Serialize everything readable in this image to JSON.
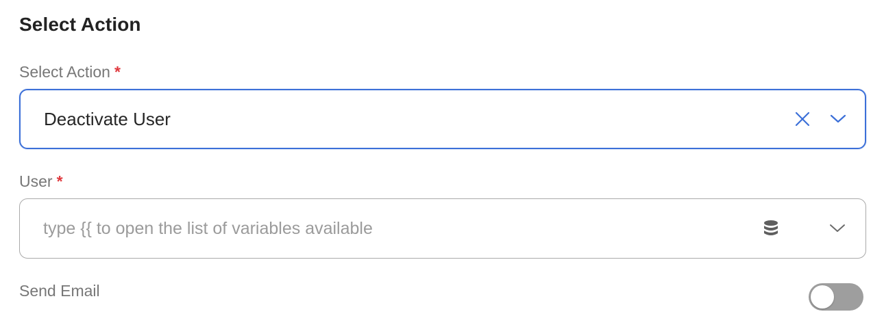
{
  "section": {
    "title": "Select Action"
  },
  "action_field": {
    "label": "Select Action",
    "required_mark": "*",
    "value": "Deactivate User",
    "clear_icon": "close-icon",
    "dropdown_icon": "chevron-down-icon"
  },
  "user_field": {
    "label": "User",
    "required_mark": "*",
    "placeholder": "type {{ to open the list of variables available",
    "variables_icon": "database-icon",
    "dropdown_icon": "chevron-down-icon"
  },
  "send_email": {
    "label": "Send Email",
    "enabled": false
  },
  "colors": {
    "accent": "#3b6fd8",
    "required": "#e0393e",
    "toggle_off": "#9e9e9e"
  }
}
